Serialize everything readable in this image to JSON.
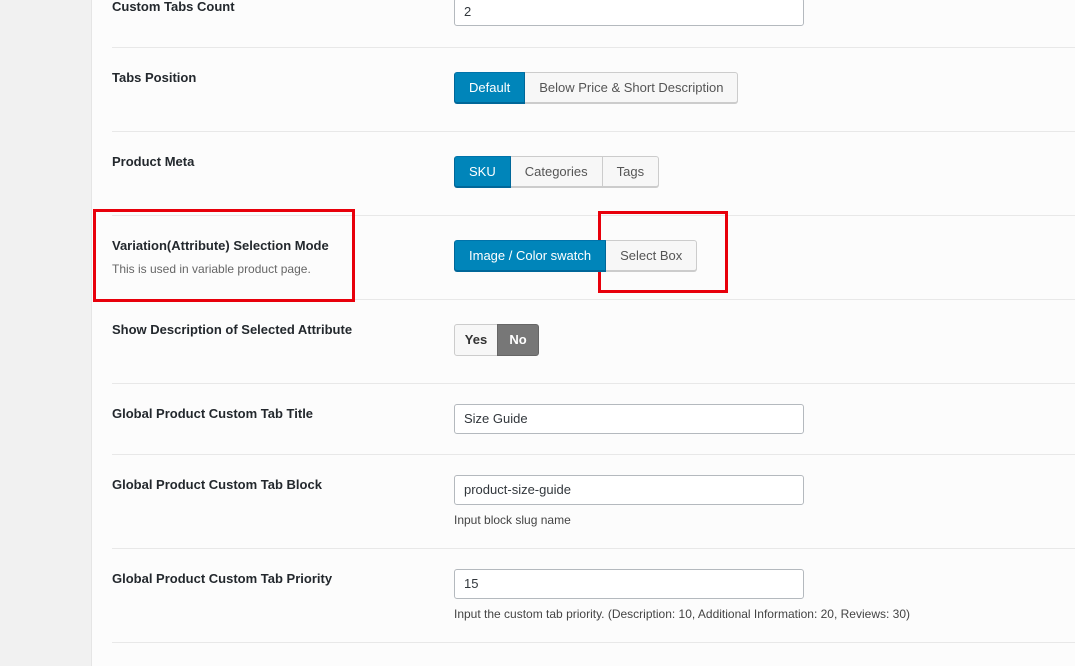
{
  "settings": {
    "custom_tabs_count": {
      "label": "Custom Tabs Count",
      "value": "2"
    },
    "tabs_position": {
      "label": "Tabs Position",
      "options": [
        "Default",
        "Below Price & Short Description"
      ],
      "selected": "Default"
    },
    "product_meta": {
      "label": "Product Meta",
      "options": [
        "SKU",
        "Categories",
        "Tags"
      ],
      "selected": "SKU"
    },
    "variation_mode": {
      "label": "Variation(Attribute) Selection Mode",
      "description": "This is used in variable product page.",
      "options": [
        "Image / Color swatch",
        "Select Box"
      ],
      "selected": "Image / Color swatch"
    },
    "show_description": {
      "label": "Show Description of Selected Attribute",
      "yes_label": "Yes",
      "no_label": "No",
      "selected": "No"
    },
    "custom_tab_title": {
      "label": "Global Product Custom Tab Title",
      "value": "Size Guide"
    },
    "custom_tab_block": {
      "label": "Global Product Custom Tab Block",
      "value": "product-size-guide",
      "help": "Input block slug name"
    },
    "custom_tab_priority": {
      "label": "Global Product Custom Tab Priority",
      "value": "15",
      "help": "Input the custom tab priority. (Description: 10, Additional Information: 20, Reviews: 30)"
    }
  },
  "colors": {
    "active_button": "#0085ba",
    "highlight": "#e8000b",
    "toggle_off": "#777777"
  }
}
